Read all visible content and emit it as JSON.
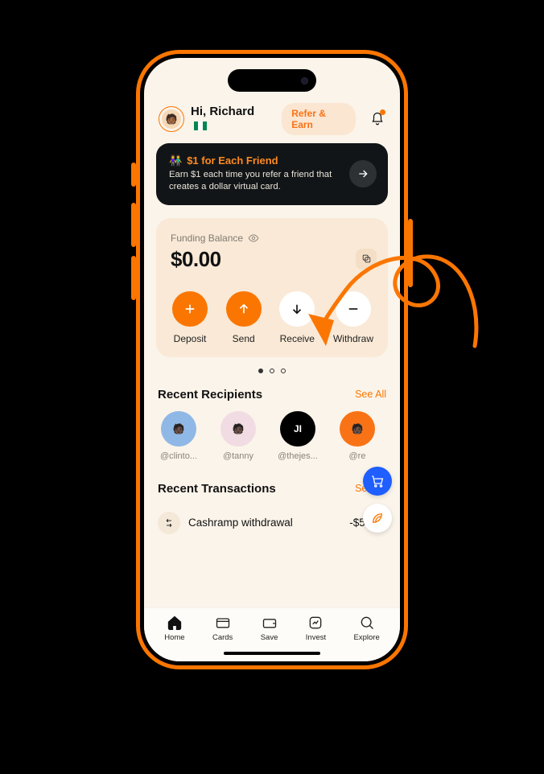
{
  "header": {
    "greeting": "Hi, Richard",
    "refer_label": "Refer & Earn"
  },
  "promo": {
    "emoji": "👫",
    "title": "$1 for Each Friend",
    "subtitle": "Earn $1 each time you refer a friend that creates a dollar virtual card."
  },
  "balance": {
    "label": "Funding Balance",
    "amount": "$0.00",
    "actions": {
      "deposit": "Deposit",
      "send": "Send",
      "receive": "Receive",
      "withdraw": "Withdraw"
    }
  },
  "recipients": {
    "title": "Recent Recipients",
    "see_all": "See All",
    "items": [
      {
        "handle": "@clinto...",
        "bg": "#8FB8E6",
        "fg": "#0A0A0A",
        "initials": ""
      },
      {
        "handle": "@tanny",
        "bg": "#F1DCE3",
        "fg": "#4A2B1C",
        "initials": ""
      },
      {
        "handle": "@thejes...",
        "bg": "#000000",
        "fg": "#FFFFFF",
        "initials": "JI"
      },
      {
        "handle": "@re",
        "bg": "#F97316",
        "fg": "#FFFFFF",
        "initials": ""
      }
    ]
  },
  "transactions": {
    "title": "Recent Transactions",
    "see_all": "See All",
    "items": [
      {
        "title": "Cashramp withdrawal",
        "amount": "-$50.00"
      }
    ]
  },
  "nav": {
    "home": "Home",
    "cards": "Cards",
    "save": "Save",
    "invest": "Invest",
    "explore": "Explore"
  },
  "colors": {
    "accent": "#FB7601"
  }
}
